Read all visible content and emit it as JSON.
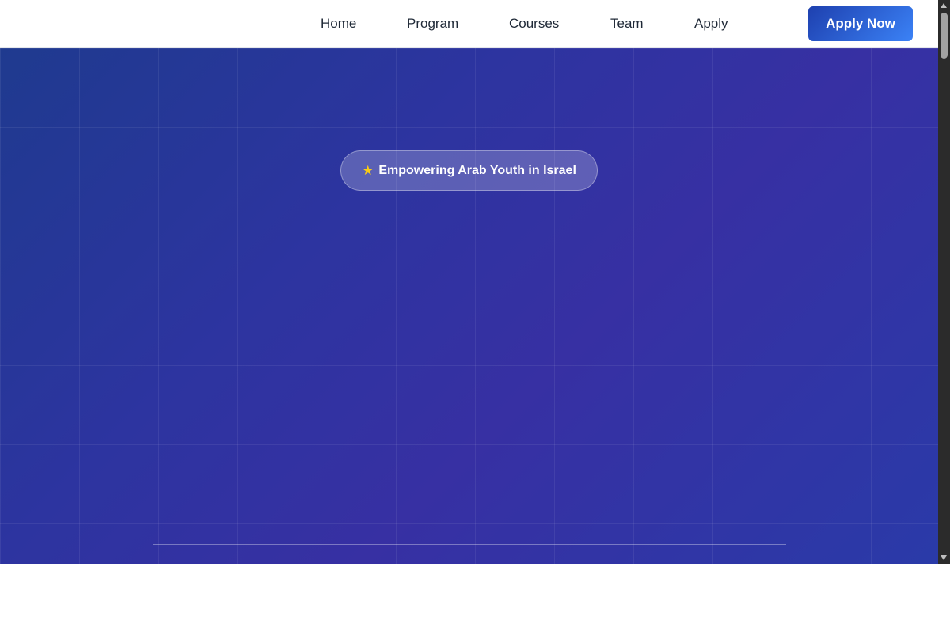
{
  "nav": {
    "links": [
      "Home",
      "Program",
      "Courses",
      "Team",
      "Apply"
    ],
    "cta_label": "Apply Now"
  },
  "hero": {
    "badge_icon": "star-icon",
    "badge_text": "Empowering Arab Youth in Israel",
    "title_line1": "",
    "title_line2": "",
    "tagline": "",
    "description": [
      "",
      "",
      ""
    ]
  },
  "colors": {
    "accent": "#1e40af",
    "hero_gradient_start": "#1f3a8f",
    "hero_gradient_end": "#3730a3"
  }
}
